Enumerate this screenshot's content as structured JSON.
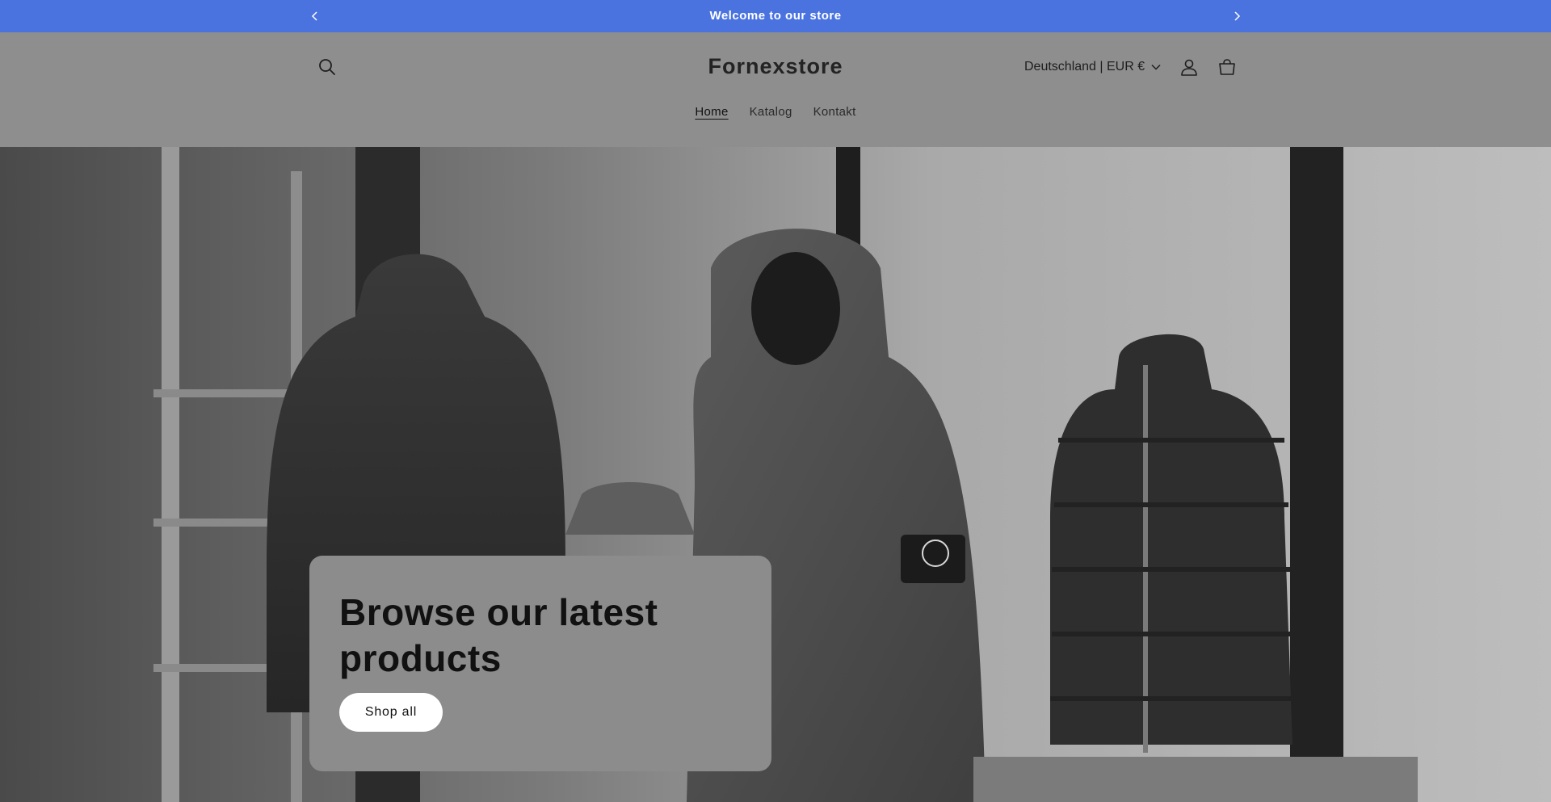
{
  "announcement": {
    "text": "Welcome to our store",
    "bg_color": "#4a73df"
  },
  "header": {
    "logo": "Fornexstore",
    "country_selector": "Deutschland | EUR €",
    "icons": [
      "search-icon",
      "account-icon",
      "cart-icon",
      "chevron-down-icon"
    ]
  },
  "nav": {
    "items": [
      {
        "label": "Home",
        "active": true
      },
      {
        "label": "Katalog",
        "active": false
      },
      {
        "label": "Kontakt",
        "active": false
      }
    ]
  },
  "hero": {
    "heading": "Browse our latest products",
    "button_label": "Shop all"
  }
}
